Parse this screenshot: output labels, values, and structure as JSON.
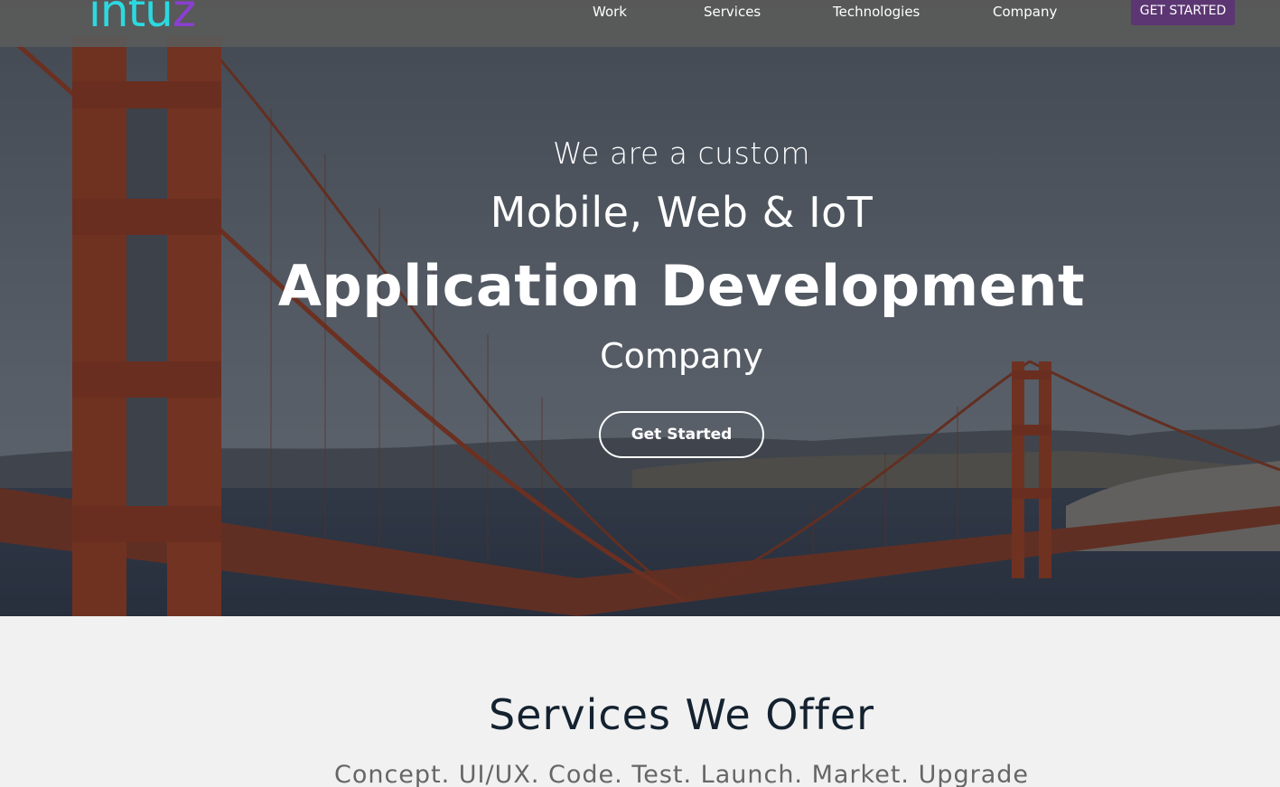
{
  "navbar": {
    "logo_main": "intu",
    "logo_accent": "z",
    "links": [
      "Work",
      "Services",
      "Technologies",
      "Company"
    ],
    "cta_label": "GET STARTED",
    "cta_color": "#5c3672"
  },
  "hero": {
    "line1": "We are a custom",
    "line2": "Mobile, Web & IoT",
    "line3": "Application Development",
    "line4": "Company",
    "button_label": "Get Started"
  },
  "services": {
    "title": "Services We Offer",
    "subtitle": "Concept. UI/UX. Code. Test. Launch. Market. Upgrade"
  },
  "colors": {
    "logo": "#2bd9e0",
    "logo_accent": "#8a3fd1",
    "services_title": "#142230",
    "services_subtitle": "#666666"
  }
}
